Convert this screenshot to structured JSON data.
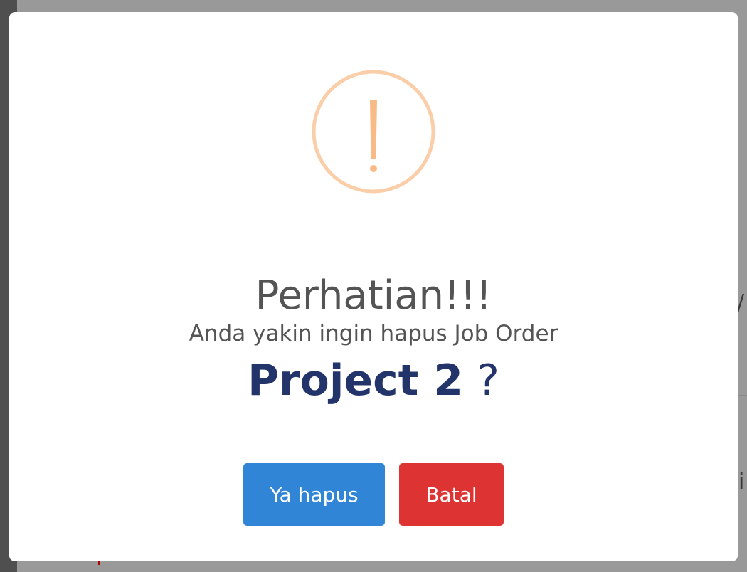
{
  "dialog": {
    "icon": "warning-exclamation-icon",
    "icon_color": "#f8bb86",
    "title": "Perhatian!!!",
    "message": "Anda yakin ingin hapus Job Order",
    "project_name": "Project 2",
    "question_mark": "?",
    "confirm_label": "Ya hapus",
    "cancel_label": "Batal",
    "confirm_color": "#3085d6",
    "cancel_color": "#dd3333",
    "project_color": "#223469"
  }
}
